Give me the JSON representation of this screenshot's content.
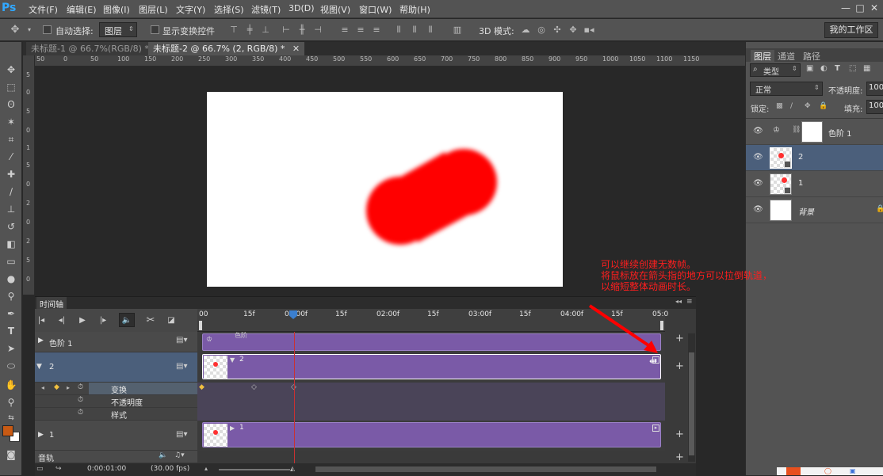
{
  "app": {
    "logo": "Ps"
  },
  "menu": [
    "文件(F)",
    "编辑(E)",
    "图像(I)",
    "图层(L)",
    "文字(Y)",
    "选择(S)",
    "滤镜(T)",
    "3D(D)",
    "视图(V)",
    "窗口(W)",
    "帮助(H)"
  ],
  "window_controls": [
    "—",
    "□",
    "✕"
  ],
  "options": {
    "auto_select_label": "自动选择:",
    "auto_select_value": "图层",
    "show_transform_label": "显示变换控件",
    "mode_3d_label": "3D 模式:",
    "workspace": "我的工作区"
  },
  "doc_tabs": [
    {
      "label": "未标题-1 @ 66.7%(RGB/8) *"
    },
    {
      "label": "未标题-2 @ 66.7% (2, RGB/8) *"
    }
  ],
  "ruler_h_ticks": [
    "50",
    "0",
    "50",
    "100",
    "150",
    "200",
    "250",
    "300",
    "350",
    "400",
    "450",
    "500",
    "550",
    "600",
    "650",
    "700",
    "750",
    "800",
    "850",
    "900",
    "950",
    "1000",
    "1050",
    "1100",
    "1150"
  ],
  "ruler_v_ticks": [
    "5",
    "0",
    "5",
    "0",
    "1",
    "5",
    "0",
    "2",
    "0",
    "2",
    "5",
    "0"
  ],
  "annotation": {
    "lines": [
      "可以继续创建无数帧。",
      "将鼠标放在箭头指的地方可以拉倒轨道，",
      "以缩短整体动画时长。"
    ],
    "color": "#ff1e1e"
  },
  "timeline": {
    "title": "时间轴",
    "ticks": [
      "00",
      "15f",
      "01:00f",
      "15f",
      "02:00f",
      "15f",
      "03:00f",
      "15f",
      "04:00f",
      "15f",
      "05:0"
    ],
    "tracks": [
      {
        "name": "色阶 1",
        "clip_label": "色阶"
      },
      {
        "name": "2",
        "clip_label": "2"
      },
      {
        "name": "1",
        "clip_label": "1"
      }
    ],
    "properties": [
      "变换",
      "不透明度",
      "样式"
    ],
    "audio_label": "音轨",
    "footer_time": "0:00:01:00",
    "footer_fps": "(30.00 fps)",
    "clip_color": "#7a5aa7",
    "playhead_color": "#c83232"
  },
  "panel": {
    "tabs": [
      "图层",
      "通道",
      "路径"
    ],
    "filter_label": "类型",
    "blend_mode": "正常",
    "opacity_label": "不透明度:",
    "opacity_value": "100",
    "lock_label": "锁定:",
    "fill_label": "填充:",
    "fill_value": "100",
    "layers": [
      {
        "name": "色阶 1",
        "selected": false
      },
      {
        "name": "2",
        "selected": true
      },
      {
        "name": "1",
        "selected": false
      },
      {
        "name": "背景",
        "selected": false
      }
    ]
  },
  "accent_colors": {
    "shape_red": "#ff0000",
    "fg_swatch": "#c85a14",
    "bg_swatch": "#ffffff",
    "selection": "#4b5f7b"
  }
}
